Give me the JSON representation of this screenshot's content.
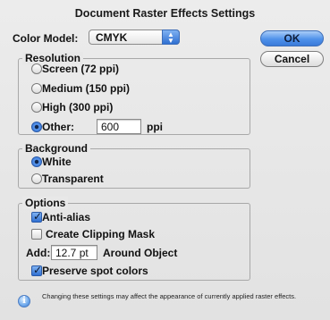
{
  "dialog": {
    "title": "Document Raster Effects Settings"
  },
  "color_model": {
    "label": "Color Model:",
    "value": "CMYK",
    "stepper_icon": "up-down-arrows-icon"
  },
  "buttons": {
    "ok": "OK",
    "cancel": "Cancel"
  },
  "resolution": {
    "label": "Resolution",
    "options": [
      {
        "label": "Screen (72 ppi)",
        "selected": false
      },
      {
        "label": "Medium (150 ppi)",
        "selected": false
      },
      {
        "label": "High (300 ppi)",
        "selected": false
      },
      {
        "label": "Other:",
        "selected": true
      }
    ],
    "other_value": "600",
    "other_unit": "ppi"
  },
  "background": {
    "label": "Background",
    "options": [
      {
        "label": "White",
        "selected": true
      },
      {
        "label": "Transparent",
        "selected": false
      }
    ]
  },
  "options": {
    "label": "Options",
    "anti_alias": {
      "label": "Anti-alias",
      "checked": true
    },
    "clipping_mask": {
      "label": "Create Clipping Mask",
      "checked": false
    },
    "add_label": "Add:",
    "add_value": "12.7 pt",
    "add_suffix": "Around Object",
    "preserve_spot": {
      "label": "Preserve spot colors",
      "checked": true
    }
  },
  "info": {
    "icon": "info-icon",
    "text": "Changing these settings may affect the appearance of currently applied raster effects."
  },
  "colors": {
    "accent": "#3a7ad9",
    "background": "#e8e8e8"
  }
}
